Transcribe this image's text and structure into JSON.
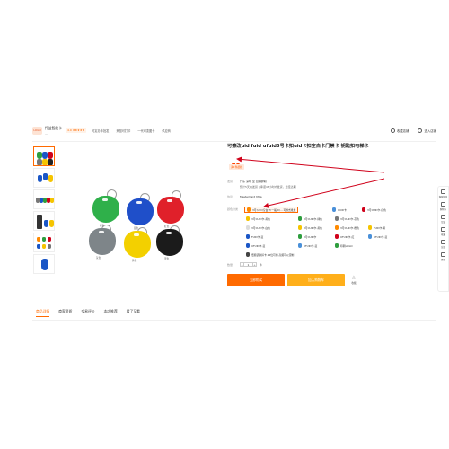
{
  "shop": {
    "logo_text": "LOGO",
    "name": "怦益智能卡",
    "sub": "—",
    "rating_label": "4.0",
    "stars": "★★★★★",
    "links": [
      "可定办卡批发",
      "来图可打印",
      "一代可变图卡",
      "供应商"
    ]
  },
  "header": {
    "favorite_shop": "收藏店铺",
    "enter_shop": "进入店铺"
  },
  "product": {
    "title": "可擦改uid fuid ufuid3号卡扣uid卡扣空白卡门禁卡 钥匙扣电梯卡",
    "currency": "¥",
    "price": "75",
    "price_tag": "满1件起批",
    "ship_label": "发货",
    "ship_from": "广东 深圳 至 自确辞职",
    "ship_note": "预计5天内发货 | 承诺48小时内发货，最佳达期",
    "protocol_label": "协议",
    "protocol_value": "MasterCard Mifa",
    "variant_label": "颜色分类",
    "quantity_label": "数量",
    "quantity": "1",
    "unit": "件",
    "buy_now": "立即购买",
    "add_cart": "加入购物车",
    "favorite": "收藏"
  },
  "variants": [
    {
      "label": "3号(UID)空白卡(一般ID)... 可擦式批发",
      "color": "#ff8a00",
      "selected": true
    },
    {
      "label": "CUID卡",
      "color": "#4a90d9",
      "selected": false
    },
    {
      "label": "3号CUID卡-红色",
      "color": "#d0021b",
      "selected": false
    },
    {
      "label": "3号CUID卡-黄色",
      "color": "#f5c400",
      "selected": false
    },
    {
      "label": "3号CUID卡-绿色",
      "color": "#2e9e3e",
      "selected": false
    },
    {
      "label": "3号CUID卡-灰色",
      "color": "#777777",
      "selected": false
    },
    {
      "label": "3号CUID卡-白色",
      "color": "#dddddd",
      "selected": false
    },
    {
      "label": "3号CUID卡-黄色",
      "color": "#f5c400",
      "selected": false
    },
    {
      "label": "3号CUID卡-橙色",
      "color": "#ff8a00",
      "selected": false
    },
    {
      "label": "FUID卡-黄",
      "color": "#f5c400",
      "selected": false
    },
    {
      "label": "FUID卡-蓝",
      "color": "#1a56c6",
      "selected": false
    },
    {
      "label": "3号CUID卡",
      "color": "#2e9e3e",
      "selected": false
    },
    {
      "label": "UFUID卡-红",
      "color": "#d0021b",
      "selected": false
    },
    {
      "label": "UFUID卡-蓝",
      "color": "#4a90d9",
      "selected": false
    },
    {
      "label": "UFUID卡-蓝",
      "color": "#1a56c6",
      "selected": false
    },
    {
      "label": "UFUID卡-蓝",
      "color": "#4a90d9",
      "selected": false
    },
    {
      "label": "印刷LOGO",
      "color": "#2e9e3e",
      "selected": false
    },
    {
      "label": "低频钥匙扣卡·12位可擦·高频可以定制",
      "color": "#444444",
      "selected": false
    }
  ],
  "main_image_labels": [
    "绿色",
    "蓝色",
    "红色",
    "灰色",
    "黄色",
    "黑色"
  ],
  "tabs": [
    "商品详情",
    "商家资质",
    "交易评价",
    "本店推荐",
    "看了又看"
  ],
  "rail": [
    "客服消息",
    "购物车",
    "足迹",
    "收藏",
    "反馈",
    "置顶"
  ],
  "colors": {
    "accent": "#ff6a00",
    "cart": "#ffaf1a",
    "arrow": "#d0021b"
  }
}
